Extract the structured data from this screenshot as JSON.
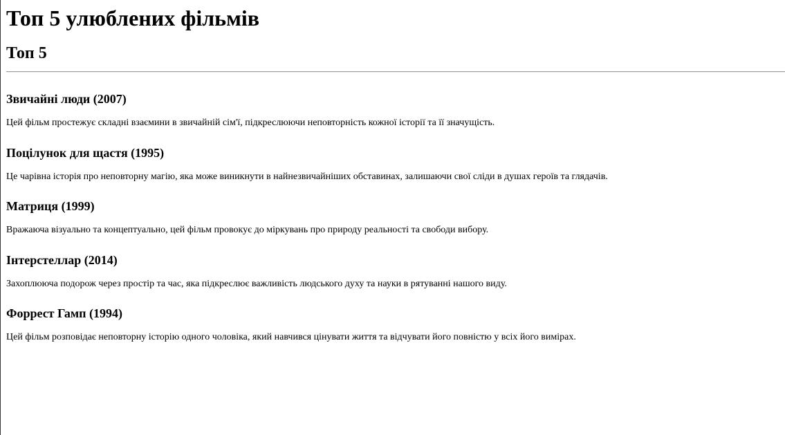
{
  "page": {
    "title": "Топ 5 улюблених фільмів",
    "subtitle": "Топ 5"
  },
  "films": [
    {
      "title": "Звичайні люди (2007)",
      "description": "Цей фільм простежує складні взаємини в звичайній сім'ї, підкреслюючи неповторність кожної історії та її значущість."
    },
    {
      "title": "Поцілунок для щастя (1995)",
      "description": "Це чарівна історія про неповторну магію, яка може виникнути в найнезвичайніших обставинах, залишаючи свої сліди в душах героїв та глядачів."
    },
    {
      "title": "Матриця (1999)",
      "description": "Вражаюча візуально та концептуально, цей фільм провокує до міркувань про природу реальності та свободи вибору."
    },
    {
      "title": "Інтерстеллар (2014)",
      "description": "Захоплююча подорож через простір та час, яка підкреслює важливість людського духу та науки в рятуванні нашого виду."
    },
    {
      "title": "Форрест Гамп (1994)",
      "description": "Цей фільм розповідає неповторну історію одного чоловіка, який навчився цінувати життя та відчувати його повністю у всіх його вимірах."
    }
  ]
}
